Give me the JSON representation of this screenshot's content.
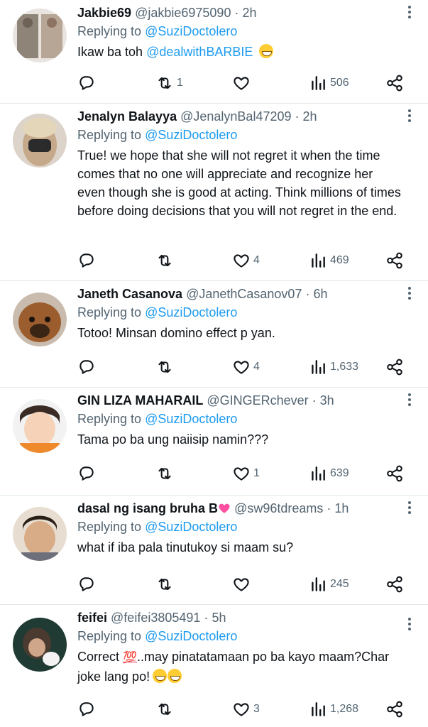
{
  "tweets": [
    {
      "name": "Jakbie69",
      "handle": "@jakbie6975090",
      "time": "2h",
      "reply_prefix": "Replying to",
      "reply_to": "@SuziDoctolero",
      "body_plain": "Ikaw ba toh",
      "body_mention": "@dealwithBARBIE",
      "retweets": "1",
      "likes": "",
      "views": "506",
      "avatar_color": "#9c8f84"
    },
    {
      "name": "Jenalyn Balayya",
      "handle": "@JenalynBal47209",
      "time": "2h",
      "reply_prefix": "Replying to",
      "reply_to": "@SuziDoctolero",
      "body": "True! we hope that she will not regret it when the time comes that no one will appreciate and recognize her even though she is good at acting. Think millions of times before doing decisions that you will not regret in the end.",
      "retweets": "",
      "likes": "4",
      "views": "469",
      "avatar_color": "#c9b39a"
    },
    {
      "name": "Janeth Casanova",
      "handle": "@JanethCasanov07",
      "time": "6h",
      "reply_prefix": "Replying to",
      "reply_to": "@SuziDoctolero",
      "body": "Totoo! Minsan domino effect p yan.",
      "retweets": "",
      "likes": "4",
      "views": "1,633",
      "avatar_color": "#8b5a2b"
    },
    {
      "name": "GIN LIZA MAHARAIL",
      "handle": "@GINGERchever",
      "time": "3h",
      "reply_prefix": "Replying to",
      "reply_to": "@SuziDoctolero",
      "body": "Tama po ba ung naiisip namin???",
      "retweets": "",
      "likes": "1",
      "views": "639",
      "avatar_color": "#f4c9a8"
    },
    {
      "name": "dasal ng isang bruha B",
      "handle": "@sw96tdreams",
      "time": "1h",
      "reply_prefix": "Replying to",
      "reply_to": "@SuziDoctolero",
      "body": "what if iba pala tinutukoy si maam su?",
      "retweets": "",
      "likes": "",
      "views": "245",
      "avatar_color": "#d8b597"
    },
    {
      "name": "feifei",
      "handle": "@feifei3805491",
      "time": "5h",
      "reply_prefix": "Replying to",
      "reply_to": "@SuziDoctolero",
      "body_a": "Correct",
      "body_b": "..may pinatatamaan po ba kayo maam?Char joke lang po!",
      "retweets": "",
      "likes": "3",
      "views": "1,268",
      "avatar_color": "#2f5d4a"
    }
  ],
  "separator_dot": "·",
  "hundred_emoji": "💯",
  "colors": {
    "accent": "#1d9bf0",
    "muted": "#536471",
    "text": "#0f1419",
    "divider": "#e1e6ea"
  }
}
